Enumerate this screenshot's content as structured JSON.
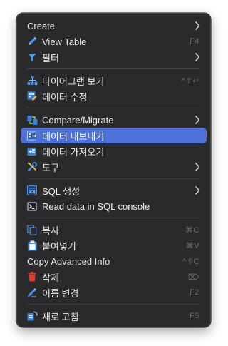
{
  "menu": {
    "items": [
      {
        "label": "Create",
        "submenu": true,
        "icon": "none"
      },
      {
        "label": "View Table",
        "shortcut": "F4",
        "icon": "pencil-icon"
      },
      {
        "label": "필터",
        "submenu": true,
        "icon": "filter-icon"
      },
      {
        "label": "다이어그램 보기",
        "shortcut": "^⇧↩",
        "icon": "diagram-icon"
      },
      {
        "label": "데이터 수정",
        "icon": "edit-data-icon"
      },
      {
        "label": "Compare/Migrate",
        "submenu": true,
        "icon": "compare-icon"
      },
      {
        "label": "데이터 내보내기",
        "icon": "export-icon",
        "selected": true
      },
      {
        "label": "데이터 가져오기",
        "icon": "import-icon"
      },
      {
        "label": "도구",
        "submenu": true,
        "icon": "tools-icon"
      },
      {
        "label": "SQL 생성",
        "submenu": true,
        "icon": "sql-icon"
      },
      {
        "label": "Read data in SQL console",
        "icon": "console-icon"
      },
      {
        "label": "복사",
        "shortcut": "⌘C",
        "icon": "copy-icon"
      },
      {
        "label": "붙여넣기",
        "shortcut": "⌘V",
        "icon": "paste-icon"
      },
      {
        "label": "Copy Advanced Info",
        "shortcut": "^⇧C",
        "icon": "none"
      },
      {
        "label": "삭제",
        "shortcut": "⌦",
        "icon": "delete-icon"
      },
      {
        "label": "이름 변경",
        "shortcut": "F2",
        "icon": "rename-icon"
      },
      {
        "label": "새로 고침",
        "shortcut": "F5",
        "icon": "refresh-icon"
      }
    ]
  },
  "colors": {
    "background": "#2a2a2c",
    "selected": "#4c72d9",
    "text": "#ececec",
    "shortcut": "#6e6e72"
  }
}
